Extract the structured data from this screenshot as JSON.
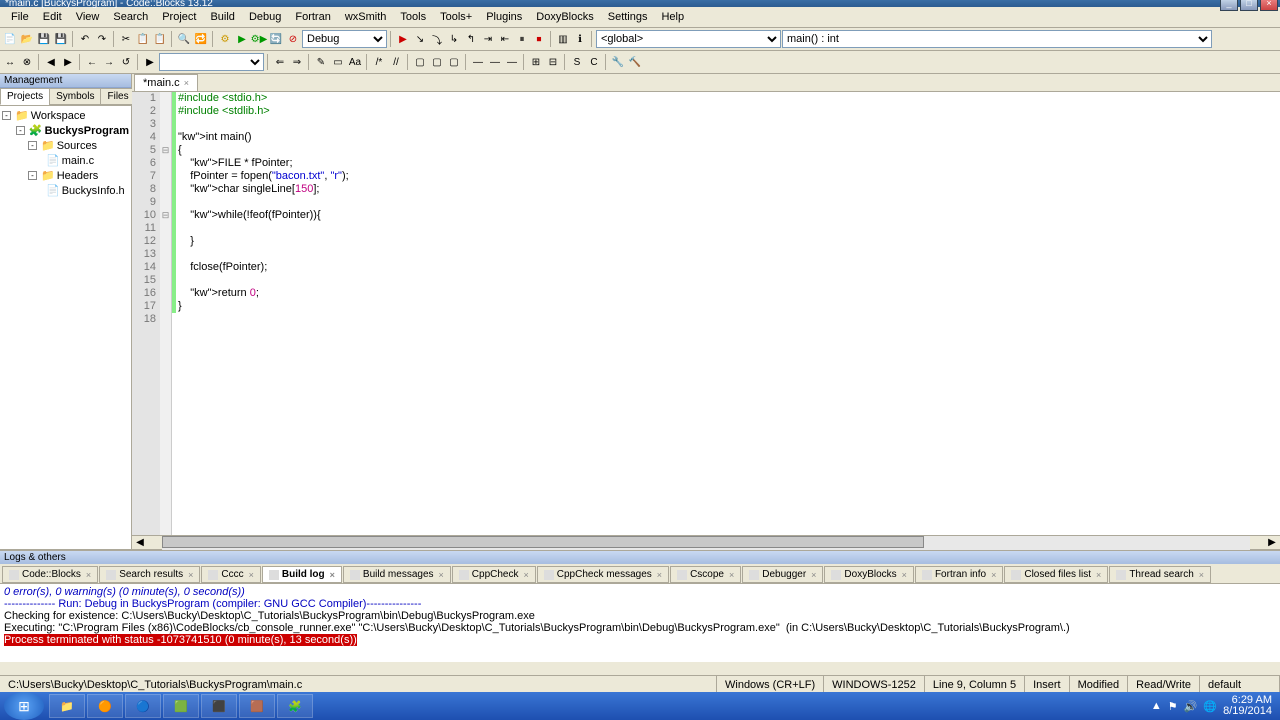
{
  "title": "*main.c [BuckysProgram] - Code::Blocks 13.12",
  "menus": [
    "File",
    "Edit",
    "View",
    "Search",
    "Project",
    "Build",
    "Debug",
    "Fortran",
    "wxSmith",
    "Tools",
    "Tools+",
    "Plugins",
    "DoxyBlocks",
    "Settings",
    "Help"
  ],
  "combo_target": "Debug",
  "combo_scope": "<global>",
  "combo_func": "main() : int",
  "sidebar": {
    "title": "Management",
    "tabs": [
      "Projects",
      "Symbols",
      "Files"
    ],
    "workspace": "Workspace",
    "project": "BuckysProgram",
    "folders": {
      "sources": "Sources",
      "headers": "Headers"
    },
    "files": {
      "mainc": "main.c",
      "header": "BuckysInfo.h"
    }
  },
  "editor_tab": "*main.c",
  "code": [
    {
      "n": 1,
      "t": "#include <stdio.h>",
      "cls": "pp"
    },
    {
      "n": 2,
      "t": "#include <stdlib.h>",
      "cls": "pp"
    },
    {
      "n": 3,
      "t": "",
      "cls": ""
    },
    {
      "n": 4,
      "t": "int main()",
      "cls": ""
    },
    {
      "n": 5,
      "t": "{",
      "cls": ""
    },
    {
      "n": 6,
      "t": "    FILE * fPointer;",
      "cls": ""
    },
    {
      "n": 7,
      "t": "    fPointer = fopen(\"bacon.txt\", \"r\");",
      "cls": ""
    },
    {
      "n": 8,
      "t": "    char singleLine[150];",
      "cls": ""
    },
    {
      "n": 9,
      "t": "",
      "cls": ""
    },
    {
      "n": 10,
      "t": "    while(!feof(fPointer)){",
      "cls": ""
    },
    {
      "n": 11,
      "t": "",
      "cls": ""
    },
    {
      "n": 12,
      "t": "    }",
      "cls": ""
    },
    {
      "n": 13,
      "t": "",
      "cls": ""
    },
    {
      "n": 14,
      "t": "    fclose(fPointer);",
      "cls": ""
    },
    {
      "n": 15,
      "t": "",
      "cls": ""
    },
    {
      "n": 16,
      "t": "    return 0;",
      "cls": ""
    },
    {
      "n": 17,
      "t": "}",
      "cls": ""
    },
    {
      "n": 18,
      "t": "",
      "cls": ""
    }
  ],
  "logs": {
    "title": "Logs & others",
    "tabs": [
      "Code::Blocks",
      "Search results",
      "Cccc",
      "Build log",
      "Build messages",
      "CppCheck",
      "CppCheck messages",
      "Cscope",
      "Debugger",
      "DoxyBlocks",
      "Fortran info",
      "Closed files list",
      "Thread search"
    ],
    "active": 3,
    "lines": [
      {
        "t": "0 error(s), 0 warning(s) (0 minute(s), 0 second(s))",
        "cls": "blue italic"
      },
      {
        "t": "",
        "cls": ""
      },
      {
        "t": "",
        "cls": ""
      },
      {
        "t": "-------------- Run: Debug in BuckysProgram (compiler: GNU GCC Compiler)---------------",
        "cls": "blue"
      },
      {
        "t": "",
        "cls": ""
      },
      {
        "t": "Checking for existence: C:\\Users\\Bucky\\Desktop\\C_Tutorials\\BuckysProgram\\bin\\Debug\\BuckysProgram.exe",
        "cls": ""
      },
      {
        "t": "Executing: \"C:\\Program Files (x86)\\CodeBlocks/cb_console_runner.exe\" \"C:\\Users\\Bucky\\Desktop\\C_Tutorials\\BuckysProgram\\bin\\Debug\\BuckysProgram.exe\"  (in C:\\Users\\Bucky\\Desktop\\C_Tutorials\\BuckysProgram\\.)",
        "cls": ""
      }
    ],
    "error": "Process terminated with status -1073741510 (0 minute(s), 13 second(s))"
  },
  "status": {
    "path": "C:\\Users\\Bucky\\Desktop\\C_Tutorials\\BuckysProgram\\main.c",
    "eol": "Windows (CR+LF)",
    "enc": "WINDOWS-1252",
    "pos": "Line 9, Column 5",
    "insert": "Insert",
    "modified": "Modified",
    "rw": "Read/Write",
    "profile": "default"
  },
  "clock": {
    "time": "6:29 AM",
    "date": "8/19/2014"
  }
}
